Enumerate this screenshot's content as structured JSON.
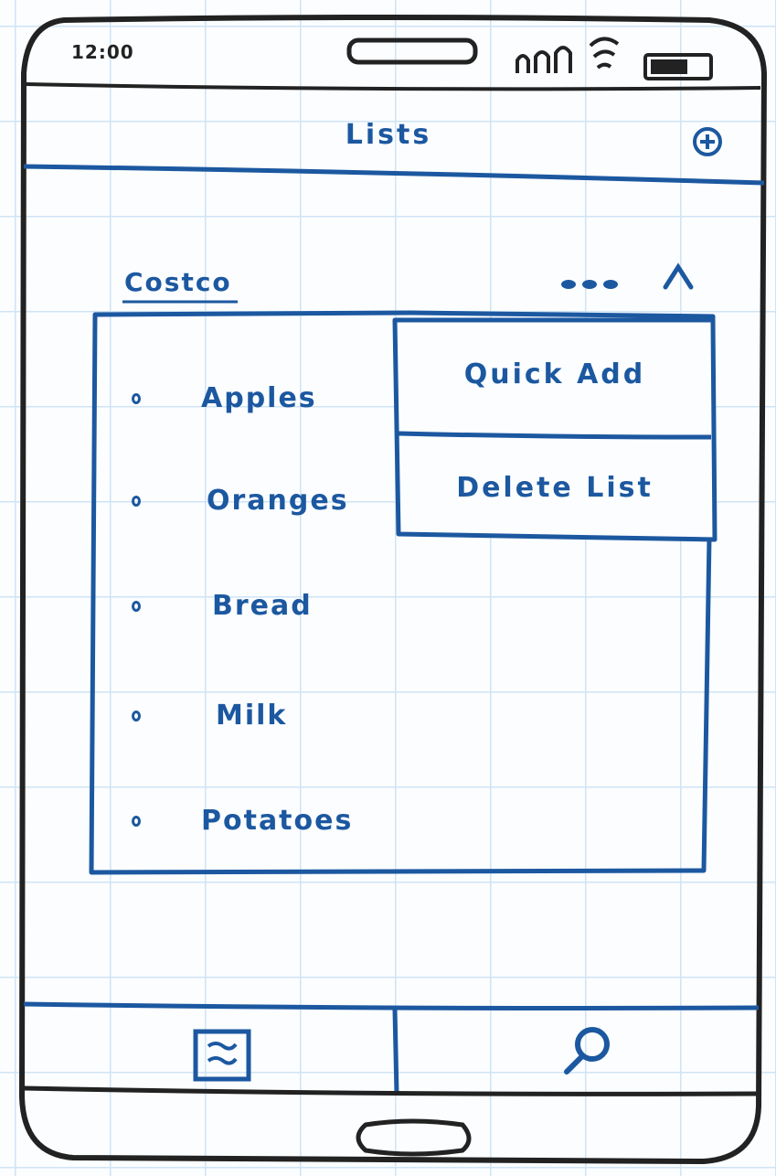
{
  "status_bar": {
    "time": "12:00"
  },
  "header": {
    "title": "Lists",
    "add_icon": "plus-circle-icon"
  },
  "list": {
    "name": "Costco",
    "more_icon": "ellipsis-icon",
    "collapse_icon": "chevron-up-icon",
    "items": [
      {
        "label": "Apples"
      },
      {
        "label": "Oranges"
      },
      {
        "label": "Bread"
      },
      {
        "label": "Milk"
      },
      {
        "label": "Potatoes"
      }
    ]
  },
  "context_menu": {
    "items": [
      {
        "label": "Quick Add"
      },
      {
        "label": "Delete List"
      }
    ]
  },
  "tab_bar": {
    "tabs": [
      {
        "icon": "list-icon"
      },
      {
        "icon": "search-icon"
      }
    ]
  },
  "colors": {
    "ink_blue": "#1c58a0",
    "frame_black": "#222222",
    "grid": "#cfe4f4"
  }
}
